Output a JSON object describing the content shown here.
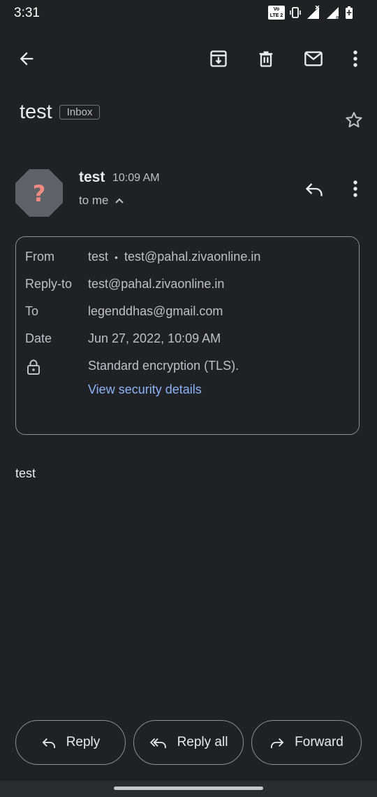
{
  "status_bar": {
    "time": "3:31",
    "volte_line1": "Vo",
    "volte_line2": "LTE 2"
  },
  "toolbar": {
    "icons": [
      "back-arrow-icon",
      "archive-icon",
      "delete-icon",
      "mark-unread-icon",
      "more-vert-icon"
    ]
  },
  "email": {
    "subject": "test",
    "label": "Inbox",
    "sender_name": "test",
    "time": "10:09 AM",
    "to_line": "to me",
    "avatar_glyph": "?",
    "details": {
      "from_label": "From",
      "from_name": "test",
      "from_separator": "•",
      "from_email": "test@pahal.zivaonline.in",
      "reply_to_label": "Reply-to",
      "reply_to_value": "test@pahal.zivaonline.in",
      "to_label": "To",
      "to_value": "legenddhas@gmail.com",
      "date_label": "Date",
      "date_value": "Jun 27, 2022, 10:09 AM",
      "encryption_text": "Standard encryption (TLS).",
      "security_link": "View security details"
    },
    "body": "test"
  },
  "actions": {
    "reply": "Reply",
    "reply_all": "Reply all",
    "forward": "Forward"
  },
  "colors": {
    "background": "#202124",
    "link": "#8ab4f8",
    "avatar_bg": "#5f6368",
    "avatar_glyph": "#f28b82"
  }
}
